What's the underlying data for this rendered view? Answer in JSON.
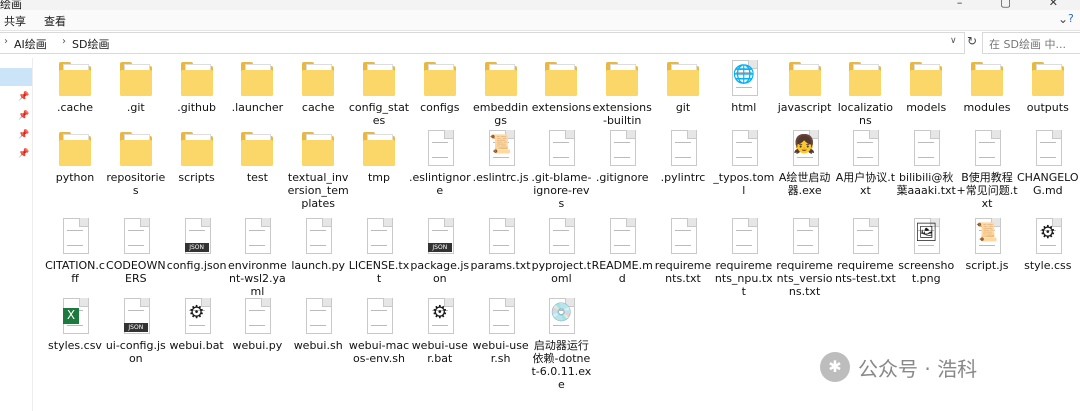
{
  "window": {
    "title": "绘画",
    "buttons": [
      "–",
      "▢",
      "✕"
    ]
  },
  "ribbon": {
    "tabs": [
      "共享",
      "查看"
    ]
  },
  "address": {
    "crumbs": [
      "AI绘画",
      "SD绘画"
    ],
    "search_placeholder": "在 SD绘画 中..."
  },
  "items": [
    {
      "name": ".cache",
      "type": "folder"
    },
    {
      "name": ".git",
      "type": "folder"
    },
    {
      "name": ".github",
      "type": "folder"
    },
    {
      "name": ".launcher",
      "type": "folder"
    },
    {
      "name": "cache",
      "type": "folder"
    },
    {
      "name": "config_states",
      "type": "folder"
    },
    {
      "name": "configs",
      "type": "folder"
    },
    {
      "name": "embeddings",
      "type": "folder"
    },
    {
      "name": "extensions",
      "type": "folder"
    },
    {
      "name": "extensions-builtin",
      "type": "folder"
    },
    {
      "name": "git",
      "type": "folder"
    },
    {
      "name": "html",
      "type": "edge"
    },
    {
      "name": "javascript",
      "type": "folder"
    },
    {
      "name": "localizations",
      "type": "folder"
    },
    {
      "name": "models",
      "type": "folder"
    },
    {
      "name": "modules",
      "type": "folder"
    },
    {
      "name": "outputs",
      "type": "folder"
    },
    {
      "name": "python",
      "type": "folder"
    },
    {
      "name": "repositories",
      "type": "folder"
    },
    {
      "name": "scripts",
      "type": "folder"
    },
    {
      "name": "test",
      "type": "folder"
    },
    {
      "name": "textual_inversion_templates",
      "type": "folder"
    },
    {
      "name": "tmp",
      "type": "folder"
    },
    {
      "name": ".eslintignore",
      "type": "file"
    },
    {
      "name": ".eslintrc.js",
      "type": "script"
    },
    {
      "name": ".git-blame-ignore-revs",
      "type": "file"
    },
    {
      "name": ".gitignore",
      "type": "file"
    },
    {
      "name": ".pylintrc",
      "type": "file"
    },
    {
      "name": "_typos.toml",
      "type": "file"
    },
    {
      "name": "A绘世启动器.exe",
      "type": "anime"
    },
    {
      "name": "A用户协议.txt",
      "type": "file"
    },
    {
      "name": "bilibili@秋葉aaaki.txt",
      "type": "file"
    },
    {
      "name": "B使用教程+常见问题.txt",
      "type": "file"
    },
    {
      "name": "CHANGELOG.md",
      "type": "file"
    },
    {
      "name": "CITATION.cff",
      "type": "file"
    },
    {
      "name": "CODEOWNERS",
      "type": "file"
    },
    {
      "name": "config.json",
      "type": "json"
    },
    {
      "name": "environment-wsl2.yaml",
      "type": "file"
    },
    {
      "name": "launch.py",
      "type": "file"
    },
    {
      "name": "LICENSE.txt",
      "type": "file"
    },
    {
      "name": "package.json",
      "type": "json"
    },
    {
      "name": "params.txt",
      "type": "file"
    },
    {
      "name": "pyproject.toml",
      "type": "file"
    },
    {
      "name": "README.md",
      "type": "file"
    },
    {
      "name": "requirements.txt",
      "type": "file"
    },
    {
      "name": "requirements_npu.txt",
      "type": "file"
    },
    {
      "name": "requirements_versions.txt",
      "type": "file"
    },
    {
      "name": "requirements-test.txt",
      "type": "file"
    },
    {
      "name": "screenshot.png",
      "type": "image"
    },
    {
      "name": "script.js",
      "type": "script"
    },
    {
      "name": "style.css",
      "type": "gear"
    },
    {
      "name": "styles.csv",
      "type": "excel"
    },
    {
      "name": "ui-config.json",
      "type": "json"
    },
    {
      "name": "webui.bat",
      "type": "bat"
    },
    {
      "name": "webui.py",
      "type": "file"
    },
    {
      "name": "webui.sh",
      "type": "file"
    },
    {
      "name": "webui-macos-env.sh",
      "type": "file"
    },
    {
      "name": "webui-user.bat",
      "type": "bat"
    },
    {
      "name": "webui-user.sh",
      "type": "file"
    },
    {
      "name": "启动器运行依赖-dotnet-6.0.11.exe",
      "type": "installer"
    }
  ],
  "watermark": {
    "text": "公众号 · 浩科"
  }
}
